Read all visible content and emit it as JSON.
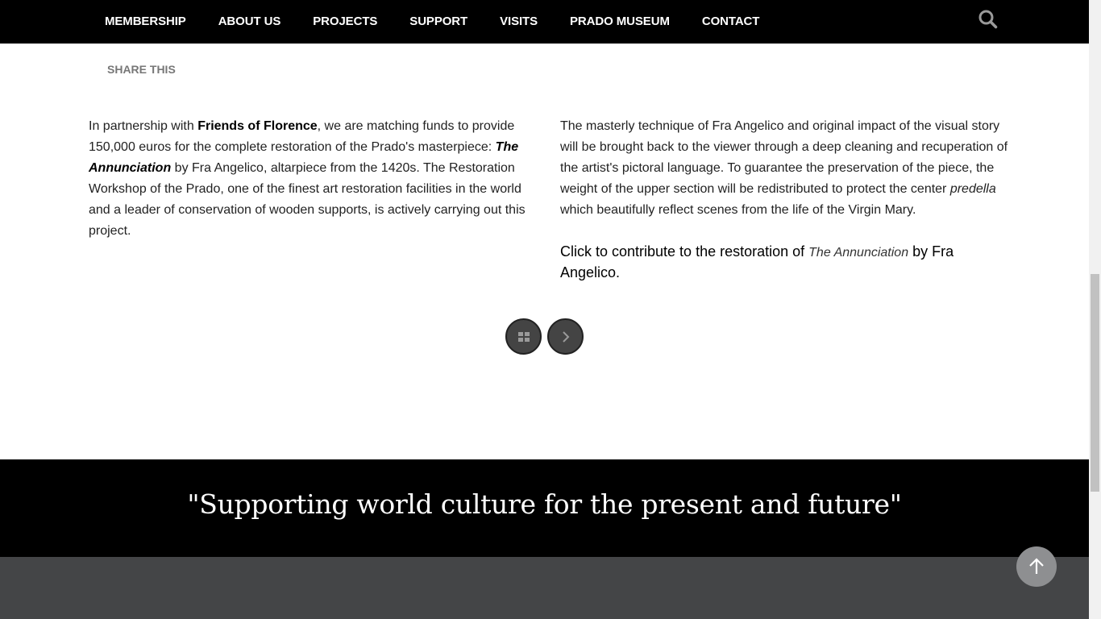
{
  "nav": {
    "items": [
      {
        "label": "MEMBERSHIP"
      },
      {
        "label": "ABOUT US"
      },
      {
        "label": "PROJECTS"
      },
      {
        "label": "SUPPORT"
      },
      {
        "label": "VISITS"
      },
      {
        "label": "PRADO MUSEUM"
      },
      {
        "label": "CONTACT"
      }
    ],
    "search_icon": "search-icon"
  },
  "share": {
    "label": "SHARE THIS"
  },
  "article": {
    "left": {
      "p1": "In partnership with ",
      "p1_bold": "Friends of Florence",
      "p2": ", we are matching funds to provide 150,000 euros for the complete restoration of the Prado's masterpiece: ",
      "p2_bolditalic": "The Annunciation",
      "p3": " by Fra Angelico, altarpiece from the 1420s. The Restoration Workshop of the Prado, one of the finest art restoration facilities in the world and a leader of conservation of wooden supports, is actively carrying out this project."
    },
    "right": {
      "p1": "The masterly technique of Fra Angelico and original impact of the visual story will be brought back to the viewer through a deep cleaning and recuperation of the artist's pictoral language. To guarantee the preservation of the piece, the weight of the upper section will be redistributed to protect the center ",
      "p1_italic": "predella",
      "p2": " which beautifully reflect scenes from the life of the Virgin Mary.",
      "cta_prefix": "Click to contribute to the restoration of ",
      "cta_italic": "The Annunciation",
      "cta_suffix": " by Fra Angelico."
    }
  },
  "pager": {
    "grid_icon": "grid-icon",
    "next_icon": "chevron-right-icon"
  },
  "quote": {
    "text": "\"Supporting world culture for the present and future\""
  },
  "back_to_top": {
    "icon": "arrow-up-icon"
  },
  "colors": {
    "nav_bg": "#000000",
    "footer_bg": "#444547",
    "button_bg": "#444444",
    "to_top_bg": "#8e8f91"
  }
}
